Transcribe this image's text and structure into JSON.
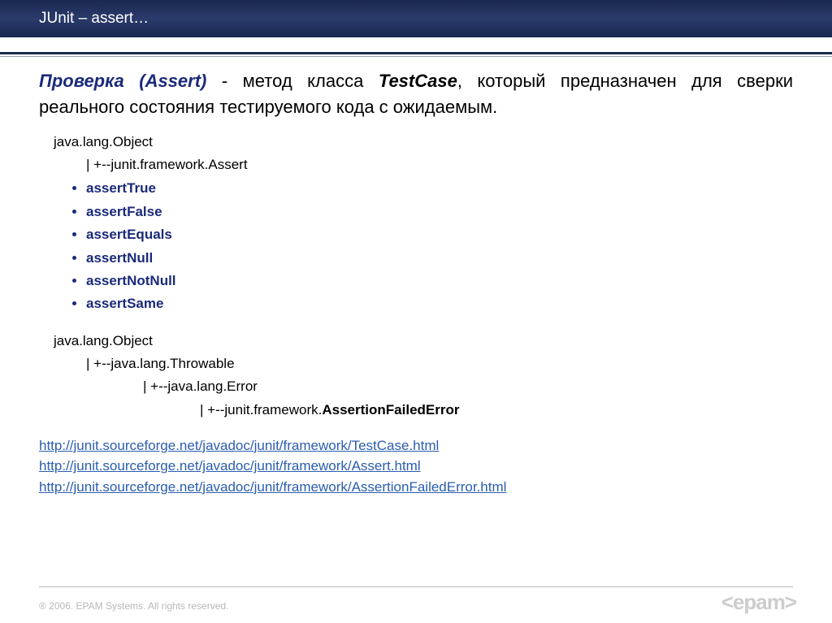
{
  "header": {
    "title": "JUnit – assert…"
  },
  "intro": {
    "term": "Проверка (Assert)",
    "mid": " - метод класса ",
    "classname": "TestCase",
    "tail": ", который предназначен для сверки реального состояния тестируемого кода с ожидаемым."
  },
  "tree1": {
    "l0": "java.lang.Object",
    "l1": "| +--junit.framework.Assert"
  },
  "asserts": [
    "assertTrue",
    "assertFalse",
    "assertEquals",
    "assertNull",
    "assertNotNull",
    "assertSame"
  ],
  "tree2": {
    "l0": "java.lang.Object",
    "l1": "| +--java.lang.Throwable",
    "l2": "| +--java.lang.Error",
    "l3a": "| +--junit.framework.",
    "l3b": "AssertionFailedError"
  },
  "links": [
    "http://junit.sourceforge.net/javadoc/junit/framework/TestCase.html",
    "http://junit.sourceforge.net/javadoc/junit/framework/Assert.html",
    "http://junit.sourceforge.net/javadoc/junit/framework/AssertionFailedError.html"
  ],
  "footer": "® 2006. EPAM Systems. All rights reserved.",
  "logo": "<epam>"
}
